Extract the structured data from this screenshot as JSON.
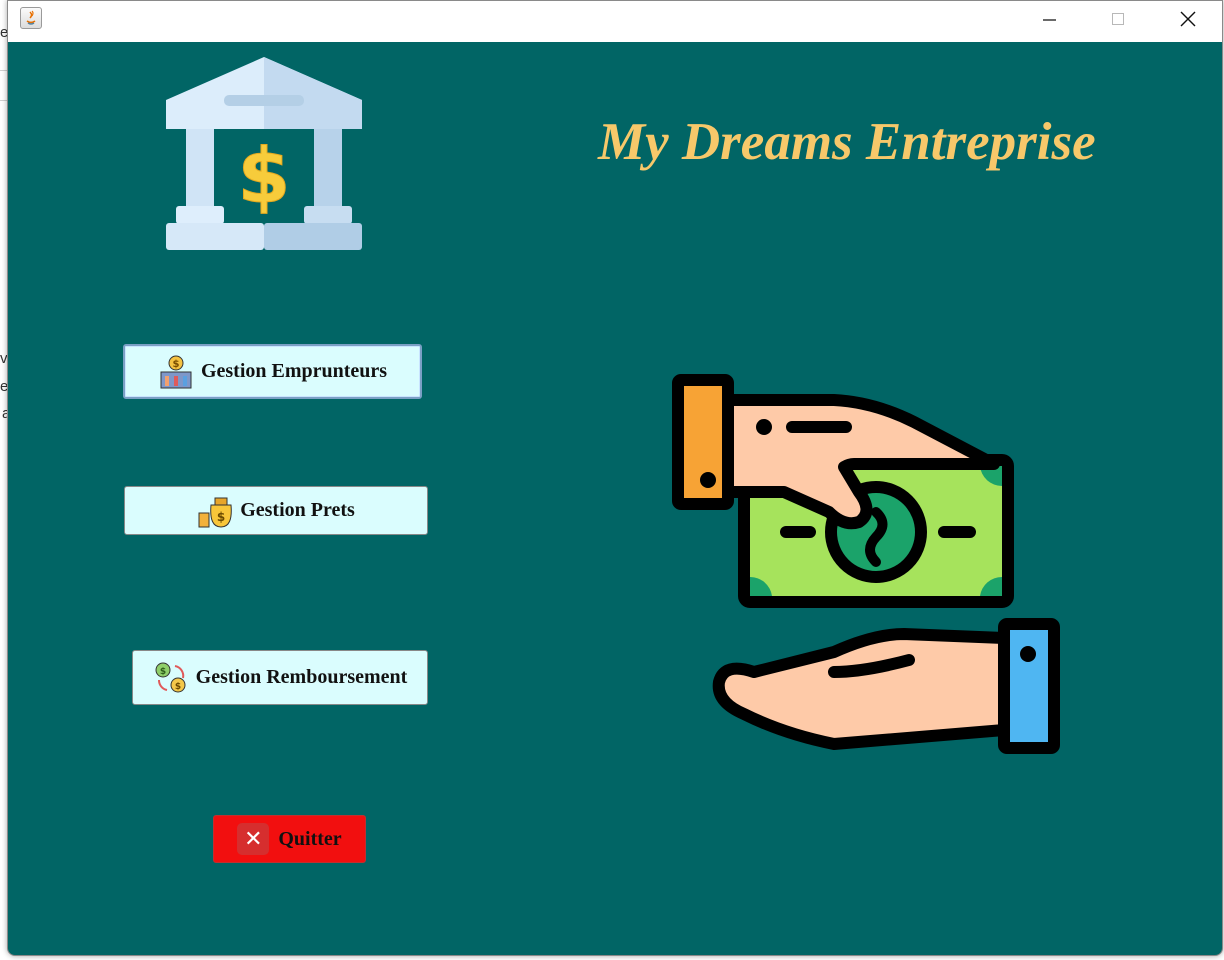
{
  "window": {
    "title": "",
    "controls": [
      "minimize",
      "maximize",
      "close"
    ]
  },
  "header": {
    "title": "My Dreams Entreprise"
  },
  "menu": {
    "buttons": [
      {
        "label": "Gestion Emprunteurs",
        "icon": "borrowers-bank-icon",
        "focused": true
      },
      {
        "label": "Gestion Prets",
        "icon": "money-bag-icon",
        "focused": false
      },
      {
        "label": "Gestion Remboursement",
        "icon": "repayment-icon",
        "focused": false
      }
    ],
    "quit": {
      "label": "Quitter",
      "icon": "close-icon"
    }
  },
  "background_fragments": [
    "e",
    "v",
    "e",
    "a"
  ],
  "colors": {
    "background": "#016565",
    "title": "#f7c86a",
    "button_bg": "#dafdfe",
    "quit_bg": "#f20f0f"
  }
}
